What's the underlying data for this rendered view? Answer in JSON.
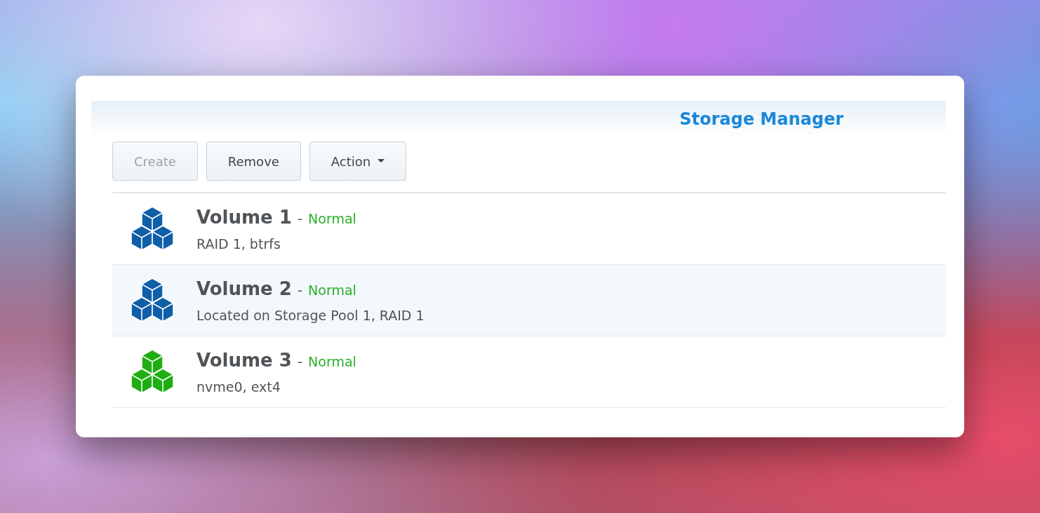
{
  "window": {
    "title": "Storage Manager"
  },
  "toolbar": [
    {
      "label": "Create",
      "kind": "plain",
      "disabled": true
    },
    {
      "label": "Remove",
      "kind": "plain",
      "disabled": false
    },
    {
      "label": "Action",
      "kind": "dropdown",
      "disabled": false
    }
  ],
  "volumes": [
    {
      "name": "Volume 1",
      "separator": "-",
      "status": "Normal",
      "detail": "RAID 1, btrfs",
      "color": "#0f5ea8",
      "selected": false
    },
    {
      "name": "Volume 2",
      "separator": "-",
      "status": "Normal",
      "detail": "Located on Storage Pool 1, RAID 1",
      "color": "#0f5ea8",
      "selected": true
    },
    {
      "name": "Volume 3",
      "separator": "-",
      "status": "Normal",
      "detail": "nvme0, ext4",
      "color": "#1fae12",
      "selected": false
    }
  ]
}
